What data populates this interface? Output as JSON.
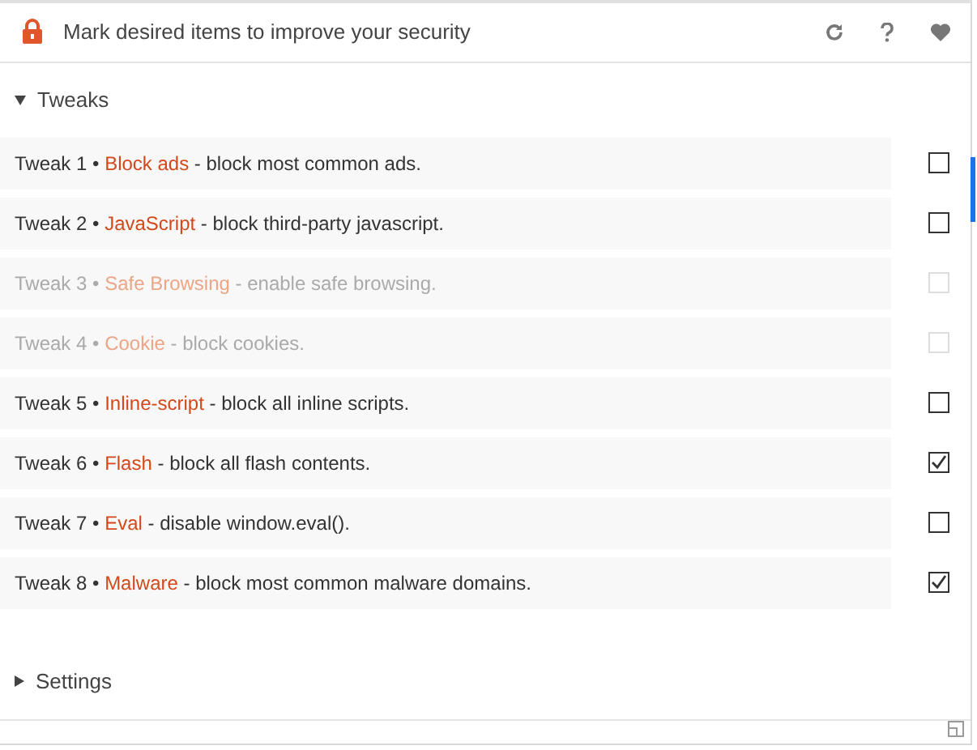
{
  "header": {
    "title": "Mark desired items to improve your security"
  },
  "sections": [
    {
      "label": "Tweaks",
      "expanded": true,
      "items": [
        {
          "prefix": "Tweak 1 •",
          "name": "Block ads",
          "description": "- block most common ads.",
          "checked": false,
          "disabled": false
        },
        {
          "prefix": "Tweak 2 •",
          "name": "JavaScript",
          "description": "- block third-party javascript.",
          "checked": false,
          "disabled": false
        },
        {
          "prefix": "Tweak 3 •",
          "name": "Safe Browsing",
          "description": "- enable safe browsing.",
          "checked": false,
          "disabled": true
        },
        {
          "prefix": "Tweak 4 •",
          "name": "Cookie",
          "description": "- block cookies.",
          "checked": false,
          "disabled": true
        },
        {
          "prefix": "Tweak 5 •",
          "name": "Inline-script",
          "description": "- block all inline scripts.",
          "checked": false,
          "disabled": false
        },
        {
          "prefix": "Tweak 6 •",
          "name": "Flash",
          "description": "- block all flash contents.",
          "checked": true,
          "disabled": false
        },
        {
          "prefix": "Tweak 7 •",
          "name": "Eval",
          "description": "- disable window.eval().",
          "checked": false,
          "disabled": false
        },
        {
          "prefix": "Tweak 8 •",
          "name": "Malware",
          "description": "- block most common malware domains.",
          "checked": true,
          "disabled": false
        }
      ]
    },
    {
      "label": "Settings",
      "expanded": false
    }
  ]
}
